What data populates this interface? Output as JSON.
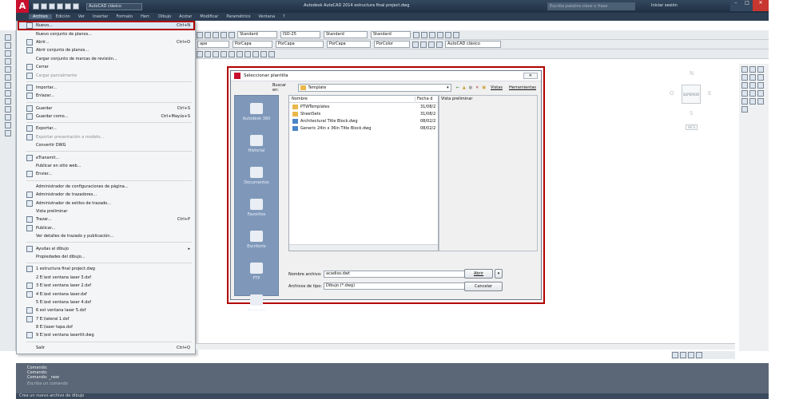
{
  "titlebar": {
    "app_title": "Autodesk AutoCAD 2014   estructura final project.dwg",
    "workspace": "AutoCAD clásico",
    "search_placeholder": "Escriba palabra clave o frase",
    "signin": "Iniciar sesión"
  },
  "menubar": {
    "items": [
      "Archivo",
      "Edición",
      "Ver",
      "Insertar",
      "Formato",
      "Herr.",
      "Dibujo",
      "Acotar",
      "Modificar",
      "Paramétrico",
      "Ventana",
      "?"
    ]
  },
  "toolbar": {
    "text_style": "Standard",
    "dim_style": "ISO-25",
    "table_style": "Standard",
    "mleader_style": "Standard",
    "workspace": "AutoCAD clásico",
    "layer": "ape",
    "linetype1": "PorCapa",
    "linetype2": "PorCapa",
    "lineweight": "PorCapa",
    "plotstyle": "PorColor"
  },
  "file_menu": {
    "items": [
      {
        "label": "Nuevo...",
        "shortcut": "Ctrl+N",
        "selected": true
      },
      {
        "label": "Nuevo conjunto de planos...",
        "shortcut": ""
      },
      {
        "label": "Abrir...",
        "shortcut": "Ctrl+O"
      },
      {
        "label": "Abrir conjunto de planos...",
        "shortcut": ""
      },
      {
        "label": "Cargar conjunto de marcas de revisión...",
        "shortcut": ""
      },
      {
        "label": "Cerrar",
        "shortcut": ""
      },
      {
        "label": "Cargar parcialmente",
        "shortcut": "",
        "disabled": true
      },
      {
        "sep": true
      },
      {
        "label": "Importar...",
        "shortcut": ""
      },
      {
        "label": "Enlazar...",
        "shortcut": ""
      },
      {
        "sep": true
      },
      {
        "label": "Guardar",
        "shortcut": "Ctrl+S"
      },
      {
        "label": "Guardar como...",
        "shortcut": "Ctrl+Mayús+S"
      },
      {
        "sep": true
      },
      {
        "label": "Exportar...",
        "shortcut": ""
      },
      {
        "label": "Exportar presentación a modelo...",
        "shortcut": "",
        "disabled": true
      },
      {
        "label": "Convertir DWG",
        "shortcut": ""
      },
      {
        "sep": true
      },
      {
        "label": "eTransmit...",
        "shortcut": ""
      },
      {
        "label": "Publicar en sitio web...",
        "shortcut": ""
      },
      {
        "label": "Enviar...",
        "shortcut": ""
      },
      {
        "sep": true
      },
      {
        "label": "Administrador de configuraciones de página...",
        "shortcut": ""
      },
      {
        "label": "Administrador de trazadores...",
        "shortcut": ""
      },
      {
        "label": "Administrador de estilos de trazado...",
        "shortcut": ""
      },
      {
        "label": "Vista preliminar",
        "shortcut": ""
      },
      {
        "label": "Trazar...",
        "shortcut": "Ctrl+P"
      },
      {
        "label": "Publicar...",
        "shortcut": ""
      },
      {
        "label": "Ver detalles de trazado y publicación...",
        "shortcut": ""
      },
      {
        "sep": true
      },
      {
        "label": "Ayudas al dibujo",
        "shortcut": "▸"
      },
      {
        "label": "Propiedades del dibujo...",
        "shortcut": ""
      },
      {
        "sep": true
      },
      {
        "label": "1 estructura final project.dwg",
        "shortcut": ""
      },
      {
        "label": "2 E:\\est ventana laser 3.dxf",
        "shortcut": ""
      },
      {
        "label": "3 E:\\est ventana laser 2.dxf",
        "shortcut": ""
      },
      {
        "label": "4 E:\\est ventana laser.dxf",
        "shortcut": ""
      },
      {
        "label": "5 E:\\est ventana laser 4.dxf",
        "shortcut": ""
      },
      {
        "label": "6 est ventana laser 5.dxf",
        "shortcut": ""
      },
      {
        "label": "7 E:\\lateral 1.dxf",
        "shortcut": ""
      },
      {
        "label": "8 E:\\laser tapa.dxf",
        "shortcut": ""
      },
      {
        "label": "9 E:\\est ventana laserttt.dwg",
        "shortcut": ""
      },
      {
        "sep": true
      },
      {
        "label": "Salir",
        "shortcut": "Ctrl+Q"
      }
    ]
  },
  "dialog": {
    "title": "Seleccionar plantilla",
    "close": "✕",
    "look_in_label": "Buscar en:",
    "look_in_value": "Template",
    "views": "Vistas",
    "tools": "Herramientas",
    "col_name": "Nombre",
    "col_date": "Fecha d",
    "preview_label": "Vista preliminar",
    "files": [
      {
        "name": "PTWTemplates",
        "date": "31/08/2"
      },
      {
        "name": "SheetSets",
        "date": "31/08/2"
      },
      {
        "name": "Architectural Title Block.dwg",
        "date": "08/02/2"
      },
      {
        "name": "Generic 24in x 36in Title Block.dwg",
        "date": "08/02/2"
      }
    ],
    "places": [
      "Autodesk 360",
      "Historial",
      "Documentos",
      "Favoritos",
      "Escritorio",
      "FTP",
      "Buzzsaw"
    ],
    "filename_label": "Nombre archivo:",
    "filename_value": "acadiso.dwt",
    "filetype_label": "Archivos de tipo:",
    "filetype_value": "Dibujo (*.dwg)",
    "open_button": "Abrir",
    "cancel_button": "Cancelar"
  },
  "viewcube": {
    "n": "N",
    "s": "S",
    "e": "E",
    "o": "O",
    "top": "SUPERIOR",
    "wcs": "WCS"
  },
  "command": {
    "lines": [
      "Comando:",
      "Comando:",
      "Comando: _new"
    ],
    "prompt": "Escriba un comando",
    "status": "Crea un nuevo archivo de dibujo"
  },
  "colors": {
    "highlight": "#b00000",
    "accent": "#c8102e"
  }
}
